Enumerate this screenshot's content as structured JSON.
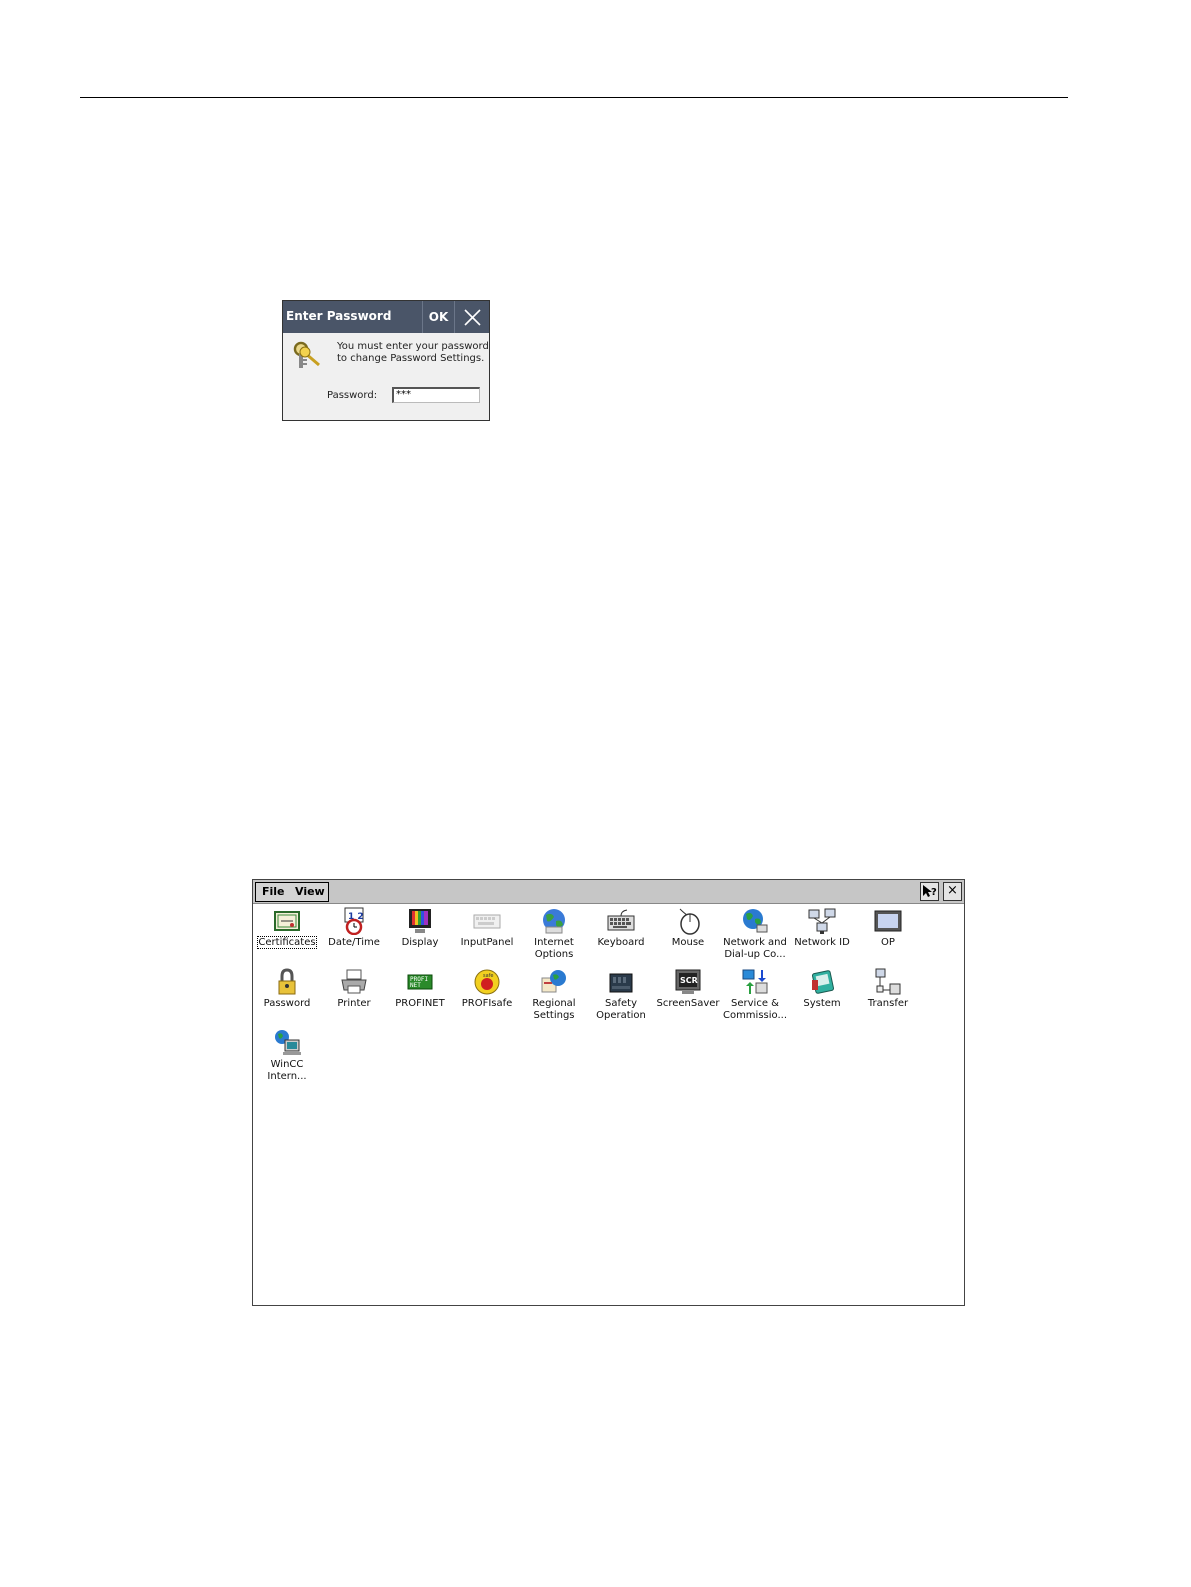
{
  "dialog": {
    "title": "Enter Password",
    "ok_label": "OK",
    "message_line1": "You must enter your password",
    "message_line2": "to change Password Settings.",
    "password_label": "Password:",
    "password_value": "***"
  },
  "control_panel": {
    "menu": {
      "file": "File",
      "view": "View"
    },
    "help_label": "?",
    "close_label": "×",
    "items": [
      {
        "label": "Certificates",
        "icon": "certificate-icon"
      },
      {
        "label": "Date/Time",
        "icon": "calendar-clock-icon"
      },
      {
        "label": "Display",
        "icon": "monitor-icon"
      },
      {
        "label": "InputPanel",
        "icon": "keyboard-panel-icon"
      },
      {
        "label": "Internet\nOptions",
        "icon": "globe-icon"
      },
      {
        "label": "Keyboard",
        "icon": "keyboard-icon"
      },
      {
        "label": "Mouse",
        "icon": "mouse-icon"
      },
      {
        "label": "Network and\nDial-up Co...",
        "icon": "network-globe-icon"
      },
      {
        "label": "Network ID",
        "icon": "network-id-icon"
      },
      {
        "label": "OP",
        "icon": "operator-panel-icon"
      },
      {
        "label": "Password",
        "icon": "padlock-icon"
      },
      {
        "label": "Printer",
        "icon": "printer-icon"
      },
      {
        "label": "PROFINET",
        "icon": "profinet-icon"
      },
      {
        "label": "PROFIsafe",
        "icon": "profisafe-icon"
      },
      {
        "label": "Regional\nSettings",
        "icon": "regional-icon"
      },
      {
        "label": "Safety\nOperation",
        "icon": "safety-device-icon"
      },
      {
        "label": "ScreenSaver",
        "icon": "screensaver-icon"
      },
      {
        "label": "Service &\nCommissio...",
        "icon": "service-icon"
      },
      {
        "label": "System",
        "icon": "system-icon"
      },
      {
        "label": "Transfer",
        "icon": "transfer-icon"
      },
      {
        "label": "WinCC\nIntern...",
        "icon": "wincc-internet-icon"
      }
    ]
  }
}
